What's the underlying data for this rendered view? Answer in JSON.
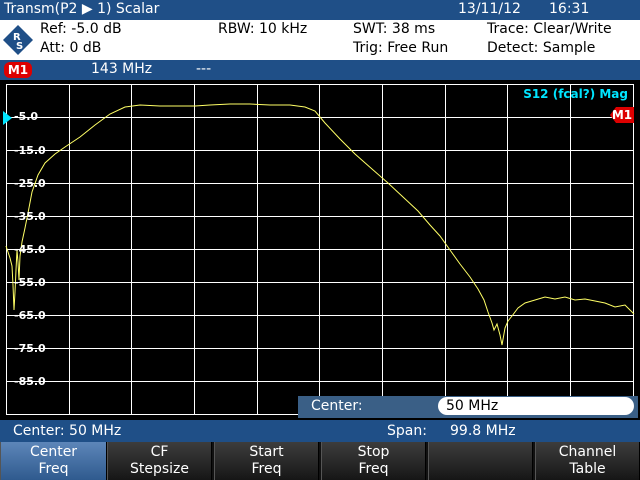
{
  "title_bar": {
    "mode": "Transm(P2 ▶ 1) Scalar",
    "date": "13/11/12",
    "time": "16:31"
  },
  "settings": {
    "ref": "Ref:  -5.0 dB",
    "att": "Att:  0 dB",
    "rbw": "RBW:  10 kHz",
    "swt": "SWT:  38 ms",
    "trig": "Trig:  Free Run",
    "trace": "Trace:  Clear/Write",
    "detect": "Detect:  Sample"
  },
  "marker_bar": {
    "badge": "M1",
    "frequency": "143 MHz",
    "value": "---"
  },
  "plot": {
    "trace_title": "S12 (fcal?) Mag",
    "marker_label": "M1",
    "y_labels": [
      "-5.0",
      "-15.0",
      "-25.0",
      "-35.0",
      "-45.0",
      "-55.0",
      "-65.0",
      "-75.0",
      "-85.0"
    ]
  },
  "center_entry": {
    "label": "Center:",
    "value": "50 MHz"
  },
  "status_bar": {
    "center": "Center: 50 MHz",
    "span_label": "Span:",
    "span_value": "99.8 MHz"
  },
  "softkeys": [
    {
      "line1": "Center",
      "line2": "Freq"
    },
    {
      "line1": "CF",
      "line2": "Stepsize"
    },
    {
      "line1": "Start",
      "line2": "Freq"
    },
    {
      "line1": "Stop",
      "line2": "Freq"
    },
    {
      "line1": "",
      "line2": ""
    },
    {
      "line1": "Channel",
      "line2": "Table"
    }
  ],
  "colors": {
    "title_bg": "#1f4f87",
    "trace": "#ffff66",
    "marker": "#dd0000",
    "trace_title": "#00e5ff"
  }
}
